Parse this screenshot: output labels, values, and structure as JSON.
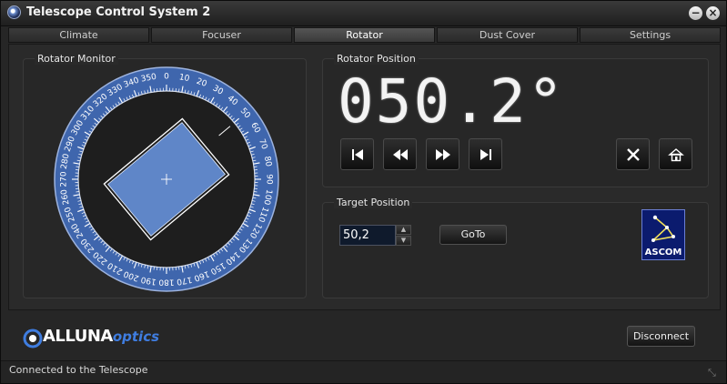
{
  "window": {
    "title": "Telescope Control System 2",
    "minimize_icon": "minimize-icon",
    "close_icon": "close-icon"
  },
  "tabs": [
    {
      "label": "Climate"
    },
    {
      "label": "Focuser"
    },
    {
      "label": "Rotator",
      "active": true
    },
    {
      "label": "Dust Cover"
    },
    {
      "label": "Settings"
    }
  ],
  "monitor": {
    "title": "Rotator Monitor",
    "dial_labels": [
      "0",
      "10",
      "20",
      "30",
      "40",
      "50",
      "60",
      "70",
      "80",
      "90",
      "100",
      "110",
      "120",
      "130",
      "140",
      "150",
      "160",
      "170",
      "180",
      "190",
      "200",
      "210",
      "220",
      "230",
      "240",
      "250",
      "260",
      "270",
      "280",
      "290",
      "300",
      "310",
      "320",
      "330",
      "340",
      "350"
    ],
    "rotation_deg": 50.2,
    "ring_color": "#3f66ad",
    "frame_color": "#5f86c8"
  },
  "position": {
    "title": "Rotator Position",
    "display": "050.2°",
    "buttons": [
      "skip-to-start-icon",
      "rewind-icon",
      "fast-forward-icon",
      "skip-to-end-icon",
      "stop-icon",
      "home-icon"
    ]
  },
  "target": {
    "title": "Target Position",
    "value": "50,2",
    "goto_label": "GoTo",
    "ascom_label": "ASCOM"
  },
  "footer": {
    "logo_main": "ALLUNA",
    "logo_sub": "optics",
    "disconnect_label": "Disconnect"
  },
  "status": {
    "text": "Connected to the Telescope"
  },
  "colors": {
    "accent": "#3f7de0",
    "background": "#262626",
    "ascom_bg": "#0b1b6e"
  }
}
